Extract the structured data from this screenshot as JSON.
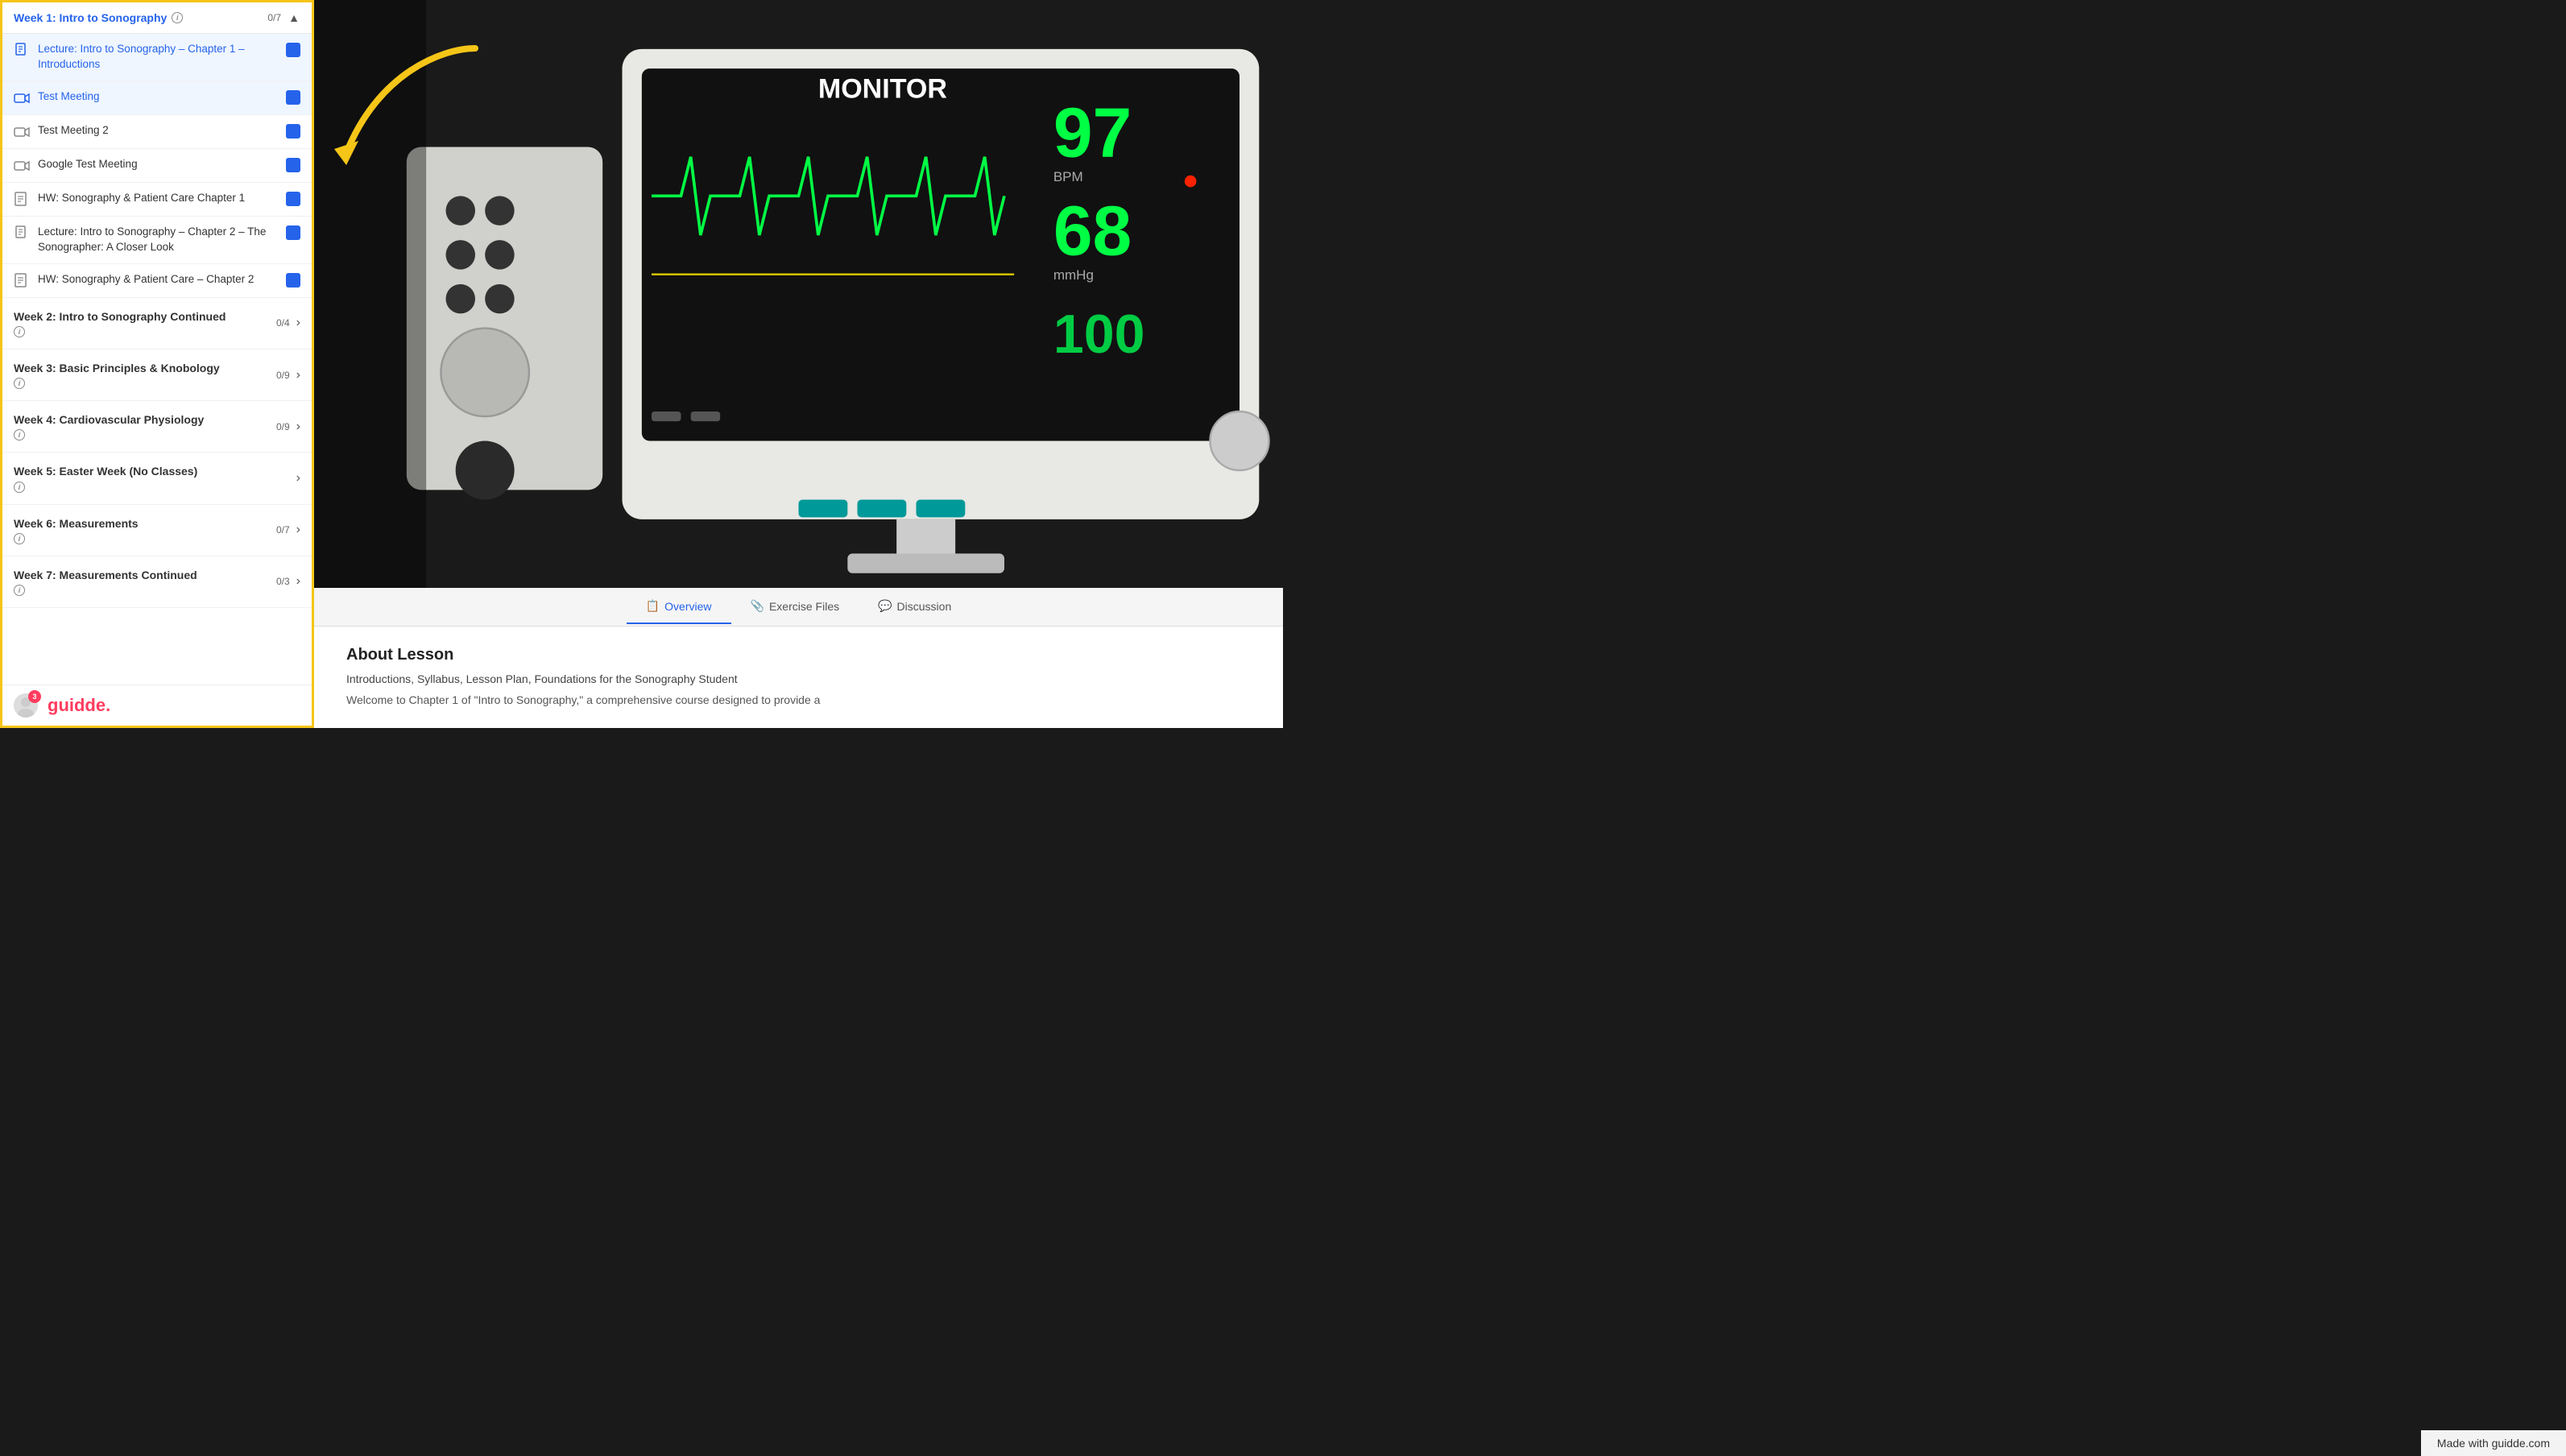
{
  "sidebar": {
    "week1": {
      "title": "Week 1: Intro to Sonography",
      "progress": "0/7",
      "items": [
        {
          "id": "lecture1",
          "type": "lecture",
          "label": "Lecture: Intro to Sonography – Chapter 1 – Introductions",
          "completed": true,
          "active": false
        },
        {
          "id": "test-meeting",
          "type": "meeting",
          "label": "Test Meeting",
          "completed": true,
          "active": true
        },
        {
          "id": "test-meeting-2",
          "type": "meeting",
          "label": "Test Meeting 2",
          "completed": true,
          "active": false
        },
        {
          "id": "google-test-meeting",
          "type": "meeting",
          "label": "Google Test Meeting",
          "completed": true,
          "active": false
        },
        {
          "id": "hw1",
          "type": "hw",
          "label": "HW: Sonography & Patient Care Chapter 1",
          "completed": true,
          "active": false
        },
        {
          "id": "lecture2",
          "type": "lecture",
          "label": "Lecture: Intro to Sonography – Chapter 2 – The Sonographer: A Closer Look",
          "completed": true,
          "active": false
        },
        {
          "id": "hw2",
          "type": "hw",
          "label": "HW: Sonography & Patient Care – Chapter 2",
          "completed": true,
          "active": false
        }
      ]
    },
    "weeks": [
      {
        "id": "week2",
        "title": "Week 2: Intro to Sonography Continued",
        "progress": "0/4",
        "hasInfo": true
      },
      {
        "id": "week3",
        "title": "Week 3: Basic Principles & Knobology",
        "progress": "0/9",
        "hasInfo": true
      },
      {
        "id": "week4",
        "title": "Week 4: Cardiovascular Physiology",
        "progress": "0/9",
        "hasInfo": true
      },
      {
        "id": "week5",
        "title": "Week 5: Easter Week (No Classes)",
        "progress": "",
        "hasInfo": true
      },
      {
        "id": "week6",
        "title": "Week 6: Measurements",
        "progress": "0/7",
        "hasInfo": true
      },
      {
        "id": "week7",
        "title": "Week 7: Measurements Continued",
        "progress": "0/3",
        "hasInfo": true
      }
    ],
    "footer": {
      "logo": "guidde.",
      "badge": "3"
    }
  },
  "tabs": [
    {
      "id": "overview",
      "label": "Overview",
      "active": true,
      "icon": "📋"
    },
    {
      "id": "exercise-files",
      "label": "Exercise Files",
      "active": false,
      "icon": "📎"
    },
    {
      "id": "discussion",
      "label": "Discussion",
      "active": false,
      "icon": "💬"
    }
  ],
  "content": {
    "about_title": "About Lesson",
    "subtitle": "Introductions, Syllabus, Lesson Plan, Foundations for the Sonography Student",
    "description": "Welcome to Chapter 1 of \"Intro to Sonography,\" a comprehensive course designed to provide a"
  },
  "footer": {
    "made_with": "Made with guidde.com"
  }
}
